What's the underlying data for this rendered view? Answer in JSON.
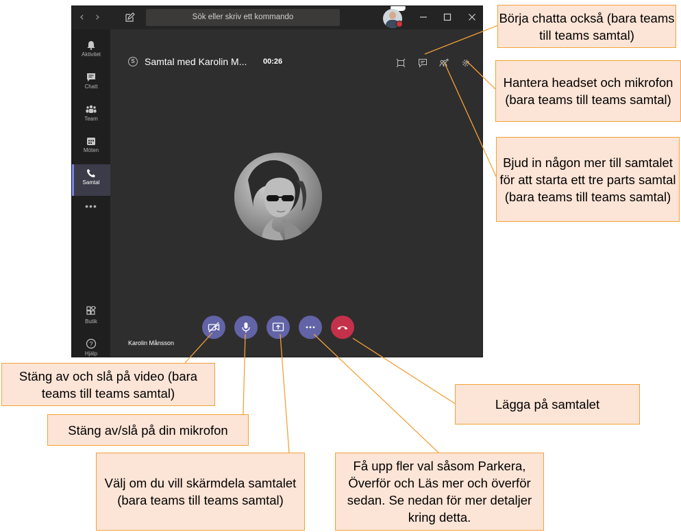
{
  "window": {
    "search_placeholder": "Sök eller skriv ett kommando",
    "nav_back": "‹",
    "nav_forward": "›"
  },
  "rail": {
    "items": [
      {
        "label": "Aktivitet"
      },
      {
        "label": "Chatt"
      },
      {
        "label": "Team"
      },
      {
        "label": "Möten"
      },
      {
        "label": "Samtal",
        "active": true
      },
      {
        "label": "Butik"
      },
      {
        "label": "Hjälp"
      }
    ],
    "more": "•••"
  },
  "call": {
    "service_icon": "S",
    "title": "Samtal med Karolin M...",
    "timer": "00:26",
    "caller_name": "Karolin Månsson"
  },
  "callouts": {
    "chat": "Börja chatta också (bara teams till teams samtal)",
    "headset": "Hantera headset och mikrofon (bara teams till teams samtal)",
    "invite": "Bjud in någon mer till samtalet för att starta ett tre parts samtal (bara teams till teams samtal)",
    "video": "Stäng av och slå på video (bara teams till teams samtal)",
    "mic": "Stäng av/slå på din mikrofon",
    "share": "Välj om du vill skärmdela samtalet (bara teams till teams samtal)",
    "more": "Få upp fler val såsom Parkera, Överför och Läs mer och överför sedan. Se nedan för mer detaljer kring detta.",
    "hangup": "Lägga på samtalet"
  },
  "colors": {
    "accent": "#6264a7",
    "hangup": "#c4314b",
    "callout_fill": "#fce4d6",
    "callout_border": "#f2a23a"
  }
}
